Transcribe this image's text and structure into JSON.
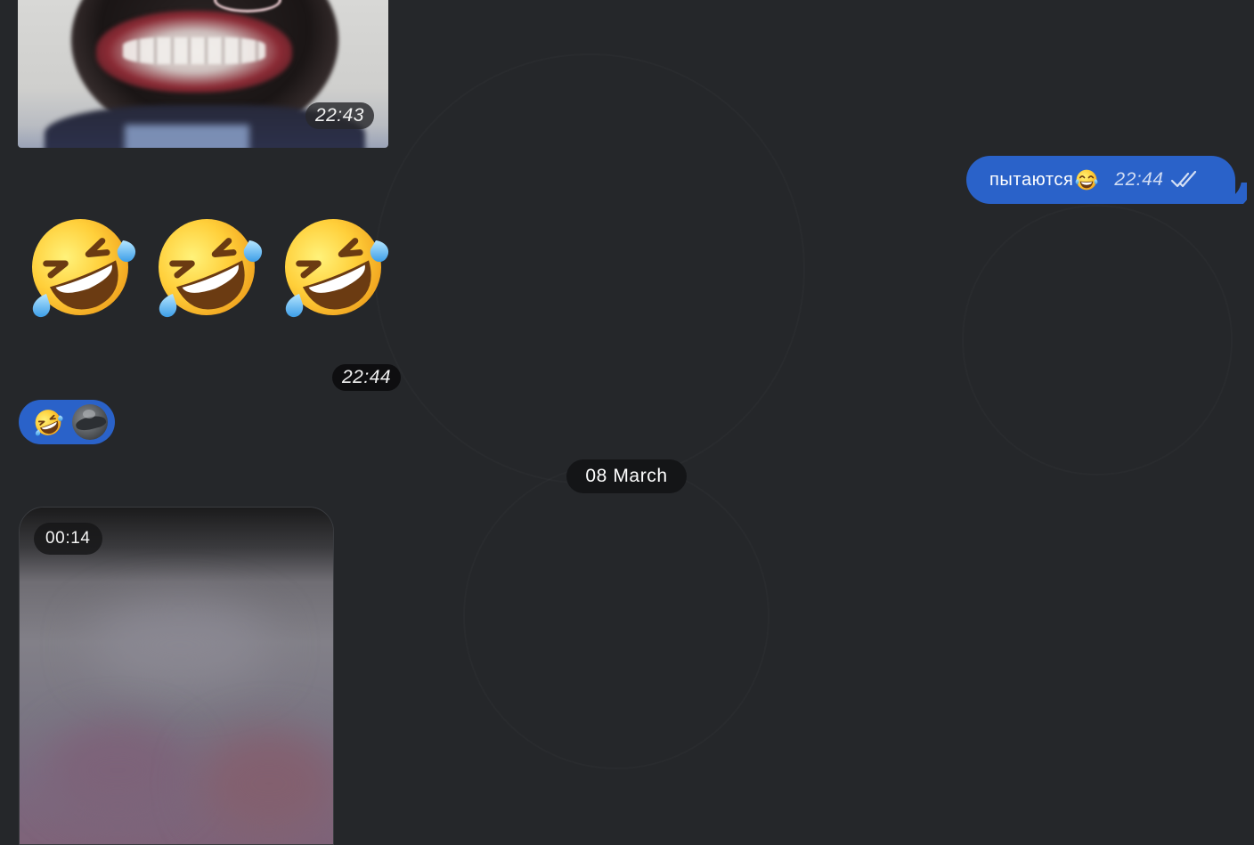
{
  "messages": {
    "photo": {
      "time": "22:43"
    },
    "outgoing_text": {
      "text": "пытаются",
      "emoji": "face-with-tears-of-joy",
      "time": "22:44",
      "status_icon": "double-check-icon"
    },
    "emoji_message": {
      "emojis": [
        "rolling-on-the-floor-laughing",
        "rolling-on-the-floor-laughing",
        "rolling-on-the-floor-laughing"
      ],
      "time": "22:44"
    },
    "reaction": {
      "emoji": "rolling-on-the-floor-laughing",
      "avatar": "reactor-avatar"
    },
    "date_separator": "08 March",
    "video": {
      "duration": "00:14"
    }
  },
  "colors": {
    "background": "#25272a",
    "outgoing_bubble": "#2a62c9",
    "date_pill": "#141517",
    "time_pill": "#000000"
  }
}
